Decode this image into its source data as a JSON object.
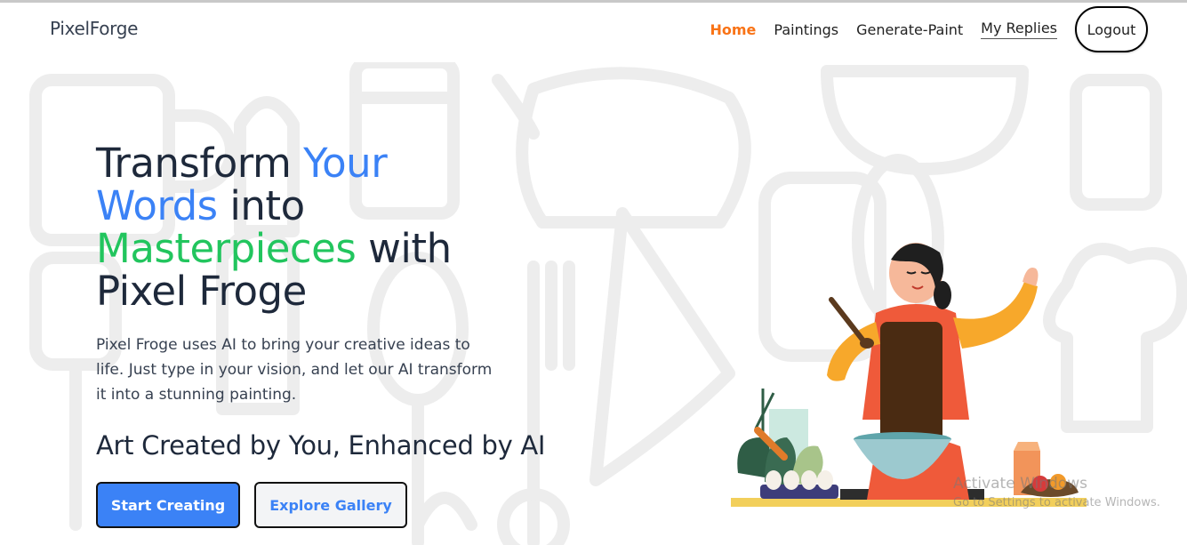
{
  "navbar": {
    "brand": "PixelForge",
    "links": [
      {
        "label": "Home"
      },
      {
        "label": "Paintings"
      },
      {
        "label": "Generate-Paint"
      },
      {
        "label": "My Replies"
      }
    ],
    "logout_label": "Logout"
  },
  "hero": {
    "title_parts": {
      "p1": "Transform ",
      "p2": "Your",
      "p3": "Words",
      "p4": " into",
      "p5": "Masterpieces",
      "p6": " with",
      "p7": "Pixel Froge"
    },
    "description": "Pixel Froge uses AI to bring your creative ideas to life. Just type in your vision, and let our AI transform it into a stunning painting.",
    "subtitle": "Art Created by You, Enhanced by AI",
    "primary_button": "Start Creating",
    "secondary_button": "Explore Gallery"
  },
  "watermark": {
    "title": "Activate Windows",
    "subtitle": "Go to Settings to activate Windows."
  },
  "colors": {
    "accent_blue": "#3b82f6",
    "accent_green": "#22c55e",
    "nav_active": "#f97316",
    "text_dark": "#1e293b"
  },
  "illustration": {
    "icon": "woman-cooking-illustration"
  }
}
